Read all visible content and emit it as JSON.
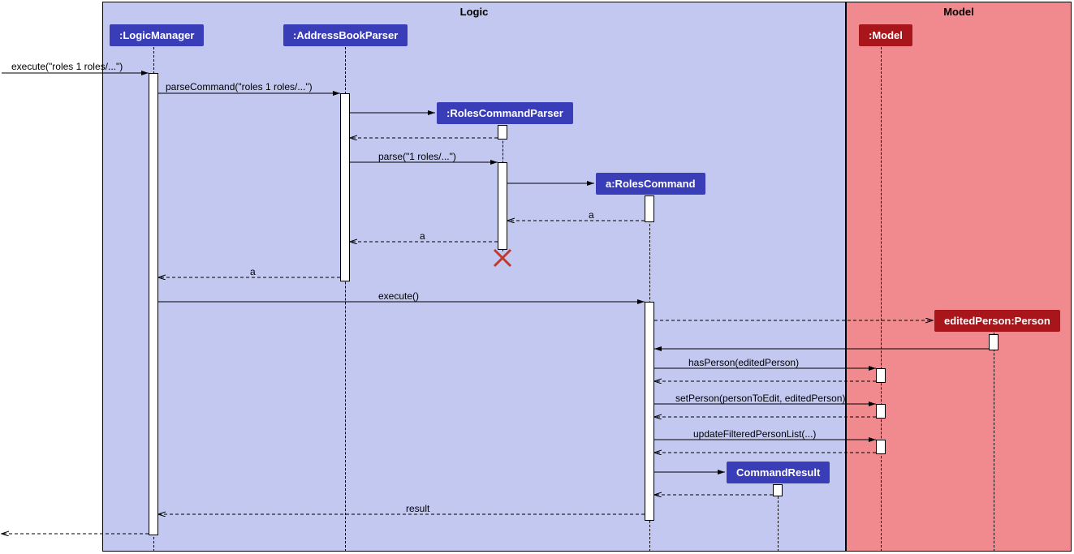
{
  "frames": {
    "logic": {
      "label": "Logic"
    },
    "model": {
      "label": "Model"
    }
  },
  "participants": {
    "logicManager": ":LogicManager",
    "addressBookParser": ":AddressBookParser",
    "rolesCommandParser": ":RolesCommandParser",
    "rolesCommand": "a:RolesCommand",
    "commandResult": "CommandResult",
    "model": ":Model",
    "editedPerson": "editedPerson:Person"
  },
  "messages": {
    "m1": "execute(\"roles 1 roles/...\")",
    "m2": "parseCommand(\"roles 1 roles/...\")",
    "m3": "parse(\"1 roles/...\")",
    "m4": "a",
    "m5": "a",
    "m6": "a",
    "m7": "execute()",
    "m8": "hasPerson(editedPerson)",
    "m9": "setPerson(personToEdit, editedPerson)",
    "m10": "updateFilteredPersonList(...)",
    "m11": "result"
  },
  "chart_data": {
    "type": "sequence-diagram",
    "frames": [
      {
        "name": "Logic",
        "participants": [
          ":LogicManager",
          ":AddressBookParser",
          ":RolesCommandParser",
          "a:RolesCommand",
          "CommandResult"
        ]
      },
      {
        "name": "Model",
        "participants": [
          ":Model",
          "editedPerson:Person"
        ]
      }
    ],
    "messages": [
      {
        "from": "caller",
        "to": ":LogicManager",
        "label": "execute(\"roles 1 roles/...\")",
        "type": "sync"
      },
      {
        "from": ":LogicManager",
        "to": ":AddressBookParser",
        "label": "parseCommand(\"roles 1 roles/...\")",
        "type": "sync"
      },
      {
        "from": ":AddressBookParser",
        "to": ":RolesCommandParser",
        "label": "",
        "type": "create"
      },
      {
        "from": ":RolesCommandParser",
        "to": ":AddressBookParser",
        "label": "",
        "type": "return"
      },
      {
        "from": ":AddressBookParser",
        "to": ":RolesCommandParser",
        "label": "parse(\"1 roles/...\")",
        "type": "sync"
      },
      {
        "from": ":RolesCommandParser",
        "to": "a:RolesCommand",
        "label": "",
        "type": "create"
      },
      {
        "from": "a:RolesCommand",
        "to": ":RolesCommandParser",
        "label": "a",
        "type": "return"
      },
      {
        "from": ":RolesCommandParser",
        "to": ":AddressBookParser",
        "label": "a",
        "type": "return"
      },
      {
        "from": ":RolesCommandParser",
        "to": "",
        "label": "",
        "type": "destroy"
      },
      {
        "from": ":AddressBookParser",
        "to": ":LogicManager",
        "label": "a",
        "type": "return"
      },
      {
        "from": ":LogicManager",
        "to": "a:RolesCommand",
        "label": "execute()",
        "type": "sync"
      },
      {
        "from": "a:RolesCommand",
        "to": "editedPerson:Person",
        "label": "",
        "type": "create"
      },
      {
        "from": "editedPerson:Person",
        "to": "a:RolesCommand",
        "label": "",
        "type": "return"
      },
      {
        "from": "a:RolesCommand",
        "to": ":Model",
        "label": "hasPerson(editedPerson)",
        "type": "sync"
      },
      {
        "from": ":Model",
        "to": "a:RolesCommand",
        "label": "",
        "type": "return"
      },
      {
        "from": "a:RolesCommand",
        "to": ":Model",
        "label": "setPerson(personToEdit, editedPerson)",
        "type": "sync"
      },
      {
        "from": ":Model",
        "to": "a:RolesCommand",
        "label": "",
        "type": "return"
      },
      {
        "from": "a:RolesCommand",
        "to": ":Model",
        "label": "updateFilteredPersonList(...)",
        "type": "sync"
      },
      {
        "from": ":Model",
        "to": "a:RolesCommand",
        "label": "",
        "type": "return"
      },
      {
        "from": "a:RolesCommand",
        "to": "CommandResult",
        "label": "",
        "type": "create"
      },
      {
        "from": "CommandResult",
        "to": "a:RolesCommand",
        "label": "",
        "type": "return"
      },
      {
        "from": "a:RolesCommand",
        "to": ":LogicManager",
        "label": "result",
        "type": "return"
      },
      {
        "from": ":LogicManager",
        "to": "caller",
        "label": "",
        "type": "return"
      }
    ]
  }
}
